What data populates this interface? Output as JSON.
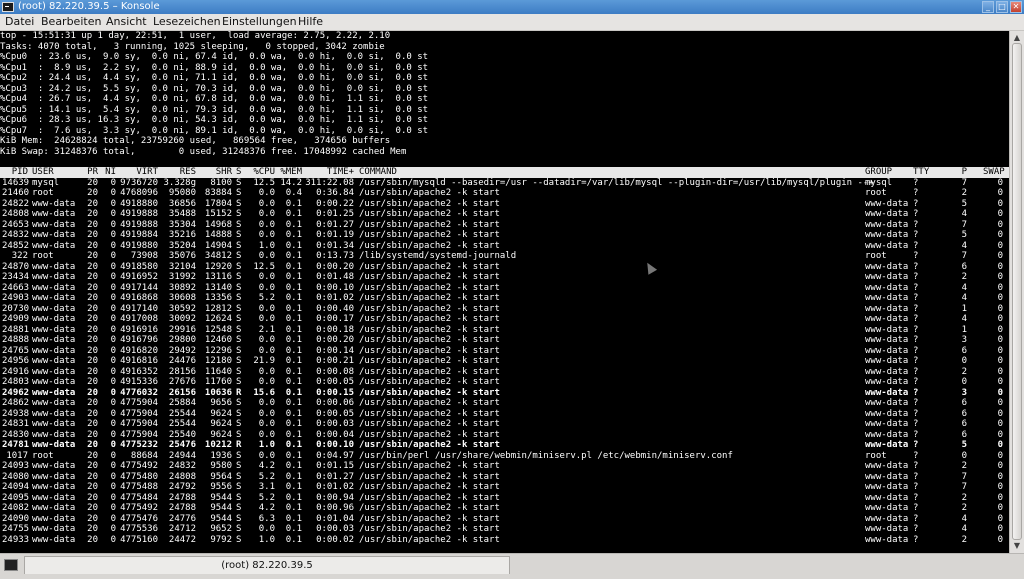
{
  "window": {
    "title": "(root) 82.220.39.5 – Konsole"
  },
  "menu": [
    "Datei",
    "Bearbeiten",
    "Ansicht",
    "Lesezeichen",
    "Einstellungen",
    "Hilfe"
  ],
  "top_summary": [
    "top - 15:51:31 up 1 day, 22:51,  1 user,  load average: 2.75, 2.22, 2.10",
    "Tasks: 4070 total,   3 running, 1025 sleeping,   0 stopped, 3042 zombie",
    "%Cpu0  : 23.6 us,  9.0 sy,  0.0 ni, 67.4 id,  0.0 wa,  0.0 hi,  0.0 si,  0.0 st",
    "%Cpu1  :  8.9 us,  2.2 sy,  0.0 ni, 88.9 id,  0.0 wa,  0.0 hi,  0.0 si,  0.0 st",
    "%Cpu2  : 24.4 us,  4.4 sy,  0.0 ni, 71.1 id,  0.0 wa,  0.0 hi,  0.0 si,  0.0 st",
    "%Cpu3  : 24.2 us,  5.5 sy,  0.0 ni, 70.3 id,  0.0 wa,  0.0 hi,  0.0 si,  0.0 st",
    "%Cpu4  : 26.7 us,  4.4 sy,  0.0 ni, 67.8 id,  0.0 wa,  0.0 hi,  1.1 si,  0.0 st",
    "%Cpu5  : 14.1 us,  5.4 sy,  0.0 ni, 79.3 id,  0.0 wa,  0.0 hi,  1.1 si,  0.0 st",
    "%Cpu6  : 28.3 us, 16.3 sy,  0.0 ni, 54.3 id,  0.0 wa,  0.0 hi,  1.1 si,  0.0 st",
    "%Cpu7  :  7.6 us,  3.3 sy,  0.0 ni, 89.1 id,  0.0 wa,  0.0 hi,  0.0 si,  0.0 st",
    "KiB Mem:  24628824 total, 23759260 used,   869564 free,   374656 buffers",
    "KiB Swap: 31248376 total,        0 used, 31248376 free. 17048992 cached Mem"
  ],
  "columns": [
    "PID",
    "USER",
    "PR",
    "NI",
    "VIRT",
    "RES",
    "SHR",
    "S",
    "%CPU",
    "%MEM",
    "TIME+",
    "COMMAND",
    "GROUP",
    "TTY",
    "P",
    "SWAP"
  ],
  "processes": [
    [
      "14639",
      "mysql",
      "20",
      "0",
      "9736720",
      "3.328g",
      "8100",
      "S",
      "12.5",
      "14.2",
      "311:22.08",
      "/usr/sbin/mysqld --basedir=/usr --datadir=/var/lib/mysql --plugin-dir=/usr/lib/mysql/plugin --+",
      "mysql",
      "?",
      "7",
      "0",
      false
    ],
    [
      "21460",
      "root",
      "20",
      "0",
      "4768096",
      "95080",
      "83884",
      "S",
      "0.0",
      "0.4",
      "0:36.84",
      "/usr/sbin/apache2 -k start",
      "root",
      "?",
      "2",
      "0",
      false
    ],
    [
      "24822",
      "www-data",
      "20",
      "0",
      "4918880",
      "36856",
      "17804",
      "S",
      "0.0",
      "0.1",
      "0:00.22",
      "/usr/sbin/apache2 -k start",
      "www-data",
      "?",
      "5",
      "0",
      false
    ],
    [
      "24808",
      "www-data",
      "20",
      "0",
      "4919888",
      "35488",
      "15152",
      "S",
      "0.0",
      "0.1",
      "0:01.25",
      "/usr/sbin/apache2 -k start",
      "www-data",
      "?",
      "4",
      "0",
      false
    ],
    [
      "24653",
      "www-data",
      "20",
      "0",
      "4919888",
      "35304",
      "14968",
      "S",
      "0.0",
      "0.1",
      "0:01.27",
      "/usr/sbin/apache2 -k start",
      "www-data",
      "?",
      "7",
      "0",
      false
    ],
    [
      "24832",
      "www-data",
      "20",
      "0",
      "4919884",
      "35216",
      "14888",
      "S",
      "0.0",
      "0.1",
      "0:01.19",
      "/usr/sbin/apache2 -k start",
      "www-data",
      "?",
      "5",
      "0",
      false
    ],
    [
      "24852",
      "www-data",
      "20",
      "0",
      "4919880",
      "35204",
      "14904",
      "S",
      "1.0",
      "0.1",
      "0:01.34",
      "/usr/sbin/apache2 -k start",
      "www-data",
      "?",
      "4",
      "0",
      false
    ],
    [
      "322",
      "root",
      "20",
      "0",
      "73908",
      "35076",
      "34812",
      "S",
      "0.0",
      "0.1",
      "0:13.73",
      "/lib/systemd/systemd-journald",
      "root",
      "?",
      "7",
      "0",
      false
    ],
    [
      "24870",
      "www-data",
      "20",
      "0",
      "4918580",
      "32104",
      "12920",
      "S",
      "12.5",
      "0.1",
      "0:00.20",
      "/usr/sbin/apache2 -k start",
      "www-data",
      "?",
      "6",
      "0",
      false
    ],
    [
      "23434",
      "www-data",
      "20",
      "0",
      "4916952",
      "31992",
      "13116",
      "S",
      "0.0",
      "0.1",
      "0:01.48",
      "/usr/sbin/apache2 -k start",
      "www-data",
      "?",
      "2",
      "0",
      false
    ],
    [
      "24663",
      "www-data",
      "20",
      "0",
      "4917144",
      "30892",
      "13140",
      "S",
      "0.0",
      "0.1",
      "0:00.10",
      "/usr/sbin/apache2 -k start",
      "www-data",
      "?",
      "4",
      "0",
      false
    ],
    [
      "24903",
      "www-data",
      "20",
      "0",
      "4916868",
      "30608",
      "13356",
      "S",
      "5.2",
      "0.1",
      "0:01.02",
      "/usr/sbin/apache2 -k start",
      "www-data",
      "?",
      "4",
      "0",
      false
    ],
    [
      "20730",
      "www-data",
      "20",
      "0",
      "4917140",
      "30592",
      "12812",
      "S",
      "0.0",
      "0.1",
      "0:00.40",
      "/usr/sbin/apache2 -k start",
      "www-data",
      "?",
      "1",
      "0",
      false
    ],
    [
      "24909",
      "www-data",
      "20",
      "0",
      "4917008",
      "30092",
      "12624",
      "S",
      "0.0",
      "0.1",
      "0:00.17",
      "/usr/sbin/apache2 -k start",
      "www-data",
      "?",
      "4",
      "0",
      false
    ],
    [
      "24881",
      "www-data",
      "20",
      "0",
      "4916916",
      "29916",
      "12548",
      "S",
      "2.1",
      "0.1",
      "0:00.18",
      "/usr/sbin/apache2 -k start",
      "www-data",
      "?",
      "1",
      "0",
      false
    ],
    [
      "24888",
      "www-data",
      "20",
      "0",
      "4916796",
      "29800",
      "12460",
      "S",
      "0.0",
      "0.1",
      "0:00.20",
      "/usr/sbin/apache2 -k start",
      "www-data",
      "?",
      "3",
      "0",
      false
    ],
    [
      "24765",
      "www-data",
      "20",
      "0",
      "4916820",
      "29492",
      "12296",
      "S",
      "0.0",
      "0.1",
      "0:00.14",
      "/usr/sbin/apache2 -k start",
      "www-data",
      "?",
      "6",
      "0",
      false
    ],
    [
      "24956",
      "www-data",
      "20",
      "0",
      "4916816",
      "24476",
      "12180",
      "S",
      "21.9",
      "0.1",
      "0:00.21",
      "/usr/sbin/apache2 -k start",
      "www-data",
      "?",
      "0",
      "0",
      false
    ],
    [
      "24916",
      "www-data",
      "20",
      "0",
      "4916352",
      "28156",
      "11640",
      "S",
      "0.0",
      "0.1",
      "0:00.08",
      "/usr/sbin/apache2 -k start",
      "www-data",
      "?",
      "2",
      "0",
      false
    ],
    [
      "24803",
      "www-data",
      "20",
      "0",
      "4915336",
      "27676",
      "11760",
      "S",
      "0.0",
      "0.1",
      "0:00.05",
      "/usr/sbin/apache2 -k start",
      "www-data",
      "?",
      "0",
      "0",
      false
    ],
    [
      "24962",
      "www-data",
      "20",
      "0",
      "4776032",
      "26156",
      "10636",
      "R",
      "15.6",
      "0.1",
      "0:00.15",
      "/usr/sbin/apache2 -k start",
      "www-data",
      "?",
      "3",
      "0",
      true
    ],
    [
      "24862",
      "www-data",
      "20",
      "0",
      "4775904",
      "25884",
      "9656",
      "S",
      "0.0",
      "0.1",
      "0:00.06",
      "/usr/sbin/apache2 -k start",
      "www-data",
      "?",
      "6",
      "0",
      false
    ],
    [
      "24938",
      "www-data",
      "20",
      "0",
      "4775904",
      "25544",
      "9624",
      "S",
      "0.0",
      "0.1",
      "0:00.05",
      "/usr/sbin/apache2 -k start",
      "www-data",
      "?",
      "6",
      "0",
      false
    ],
    [
      "24831",
      "www-data",
      "20",
      "0",
      "4775904",
      "25544",
      "9624",
      "S",
      "0.0",
      "0.1",
      "0:00.03",
      "/usr/sbin/apache2 -k start",
      "www-data",
      "?",
      "6",
      "0",
      false
    ],
    [
      "24830",
      "www-data",
      "20",
      "0",
      "4775904",
      "25540",
      "9624",
      "S",
      "0.0",
      "0.1",
      "0:00.04",
      "/usr/sbin/apache2 -k start",
      "www-data",
      "?",
      "6",
      "0",
      false
    ],
    [
      "24781",
      "www-data",
      "20",
      "0",
      "4775232",
      "25476",
      "10212",
      "R",
      "1.0",
      "0.1",
      "0:00.10",
      "/usr/sbin/apache2 -k start",
      "www-data",
      "?",
      "5",
      "0",
      true
    ],
    [
      "1017",
      "root",
      "20",
      "0",
      "88684",
      "24944",
      "1936",
      "S",
      "0.0",
      "0.1",
      "0:04.97",
      "/usr/bin/perl /usr/share/webmin/miniserv.pl /etc/webmin/miniserv.conf",
      "root",
      "?",
      "0",
      "0",
      false
    ],
    [
      "24093",
      "www-data",
      "20",
      "0",
      "4775492",
      "24832",
      "9580",
      "S",
      "4.2",
      "0.1",
      "0:01.15",
      "/usr/sbin/apache2 -k start",
      "www-data",
      "?",
      "2",
      "0",
      false
    ],
    [
      "24080",
      "www-data",
      "20",
      "0",
      "4775480",
      "24808",
      "9564",
      "S",
      "5.2",
      "0.1",
      "0:01.27",
      "/usr/sbin/apache2 -k start",
      "www-data",
      "?",
      "7",
      "0",
      false
    ],
    [
      "24094",
      "www-data",
      "20",
      "0",
      "4775488",
      "24792",
      "9556",
      "S",
      "3.1",
      "0.1",
      "0:01.02",
      "/usr/sbin/apache2 -k start",
      "www-data",
      "?",
      "7",
      "0",
      false
    ],
    [
      "24095",
      "www-data",
      "20",
      "0",
      "4775484",
      "24788",
      "9544",
      "S",
      "5.2",
      "0.1",
      "0:00.94",
      "/usr/sbin/apache2 -k start",
      "www-data",
      "?",
      "2",
      "0",
      false
    ],
    [
      "24082",
      "www-data",
      "20",
      "0",
      "4775492",
      "24788",
      "9544",
      "S",
      "4.2",
      "0.1",
      "0:00.96",
      "/usr/sbin/apache2 -k start",
      "www-data",
      "?",
      "2",
      "0",
      false
    ],
    [
      "24090",
      "www-data",
      "20",
      "0",
      "4775476",
      "24776",
      "9544",
      "S",
      "6.3",
      "0.1",
      "0:01.04",
      "/usr/sbin/apache2 -k start",
      "www-data",
      "?",
      "4",
      "0",
      false
    ],
    [
      "24755",
      "www-data",
      "20",
      "0",
      "4775536",
      "24712",
      "9652",
      "S",
      "0.0",
      "0.1",
      "0:00.03",
      "/usr/sbin/apache2 -k start",
      "www-data",
      "?",
      "4",
      "0",
      false
    ],
    [
      "24933",
      "www-data",
      "20",
      "0",
      "4775160",
      "24472",
      "9792",
      "S",
      "1.0",
      "0.1",
      "0:00.02",
      "/usr/sbin/apache2 -k start",
      "www-data",
      "?",
      "2",
      "0",
      false
    ]
  ],
  "tab": {
    "label": "(root) 82.220.39.5"
  }
}
